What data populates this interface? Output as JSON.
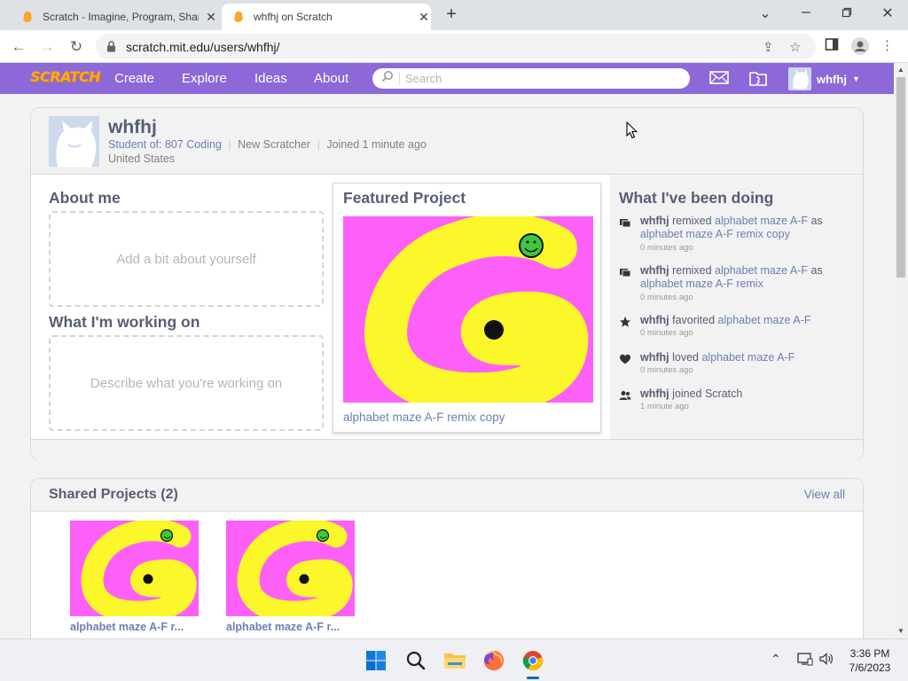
{
  "browser": {
    "tabs": [
      {
        "title": "Scratch - Imagine, Program, Shar",
        "active": false
      },
      {
        "title": "whfhj on Scratch",
        "active": true
      }
    ],
    "url": "scratch.mit.edu/users/whfhj/"
  },
  "scratch_nav": {
    "logo": "SCRATCH",
    "links": [
      "Create",
      "Explore",
      "Ideas",
      "About"
    ],
    "search_placeholder": "Search",
    "username": "whfhj"
  },
  "profile": {
    "username": "whfhj",
    "student_of_prefix": "Student of:",
    "class_name": "807 Coding",
    "rank": "New Scratcher",
    "joined": "Joined 1 minute ago",
    "location": "United States"
  },
  "about": {
    "about_header": "About me",
    "about_placeholder": "Add a bit about yourself",
    "working_header": "What I'm working on",
    "working_placeholder": "Describe what you're working on"
  },
  "featured": {
    "header": "Featured Project",
    "project_title": "alphabet maze A-F remix copy"
  },
  "activity": {
    "header": "What I've been doing",
    "items": [
      {
        "icon": "remix-icon",
        "user": "whfhj",
        "verb": " remixed ",
        "link1": "alphabet maze A-F",
        "mid": " as ",
        "link2": "alphabet maze A-F remix copy",
        "time": "0 minutes ago"
      },
      {
        "icon": "remix-icon",
        "user": "whfhj",
        "verb": " remixed ",
        "link1": "alphabet maze A-F",
        "mid": " as ",
        "link2": "alphabet maze A-F remix",
        "time": "0 minutes ago"
      },
      {
        "icon": "star-icon",
        "user": "whfhj",
        "verb": " favorited ",
        "link1": "alphabet maze A-F",
        "mid": "",
        "link2": "",
        "time": "0 minutes ago"
      },
      {
        "icon": "heart-icon",
        "user": "whfhj",
        "verb": " loved ",
        "link1": "alphabet maze A-F",
        "mid": "",
        "link2": "",
        "time": "0 minutes ago"
      },
      {
        "icon": "people-icon",
        "user": "whfhj",
        "verb": " joined Scratch",
        "link1": "",
        "mid": "",
        "link2": "",
        "time": "1 minute ago"
      }
    ]
  },
  "shared": {
    "header": "Shared Projects (2)",
    "view_all": "View all",
    "projects": [
      {
        "title": "alphabet maze A-F r..."
      },
      {
        "title": "alphabet maze A-F r..."
      }
    ]
  },
  "taskbar": {
    "time": "3:36 PM",
    "date": "7/6/2023"
  },
  "colors": {
    "scratch_purple": "#8d68d8",
    "thumb_magenta": "#fd60f9",
    "thumb_yellow": "#fbf72a",
    "link_blue": "#6b7fb4"
  }
}
